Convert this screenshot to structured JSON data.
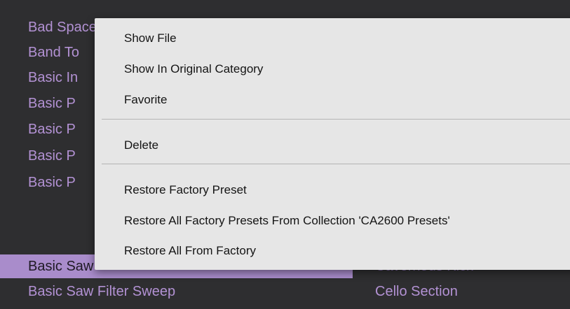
{
  "preset_list": {
    "column1": [
      "Bad Space",
      "Band To",
      "Basic In",
      "Basic P",
      "Basic P",
      "Basic P",
      "Basic P",
      "Basic Saw",
      "Basic Saw Filter Sweep"
    ],
    "column2_partial": "Cavernous Kick",
    "column2_last": "Cello Section",
    "selected_index": 7
  },
  "context_menu": {
    "items": [
      "Show File",
      "Show In Original Category",
      "Favorite",
      "Delete",
      "Restore Factory Preset",
      "Restore All Factory Presets From Collection 'CA2600 Presets'",
      "Restore All From Factory"
    ]
  },
  "colors": {
    "background": "#2e2e30",
    "preset_text": "#b392d4",
    "selected_bg": "#a98ccb",
    "menu_bg": "#e6e6e6"
  }
}
